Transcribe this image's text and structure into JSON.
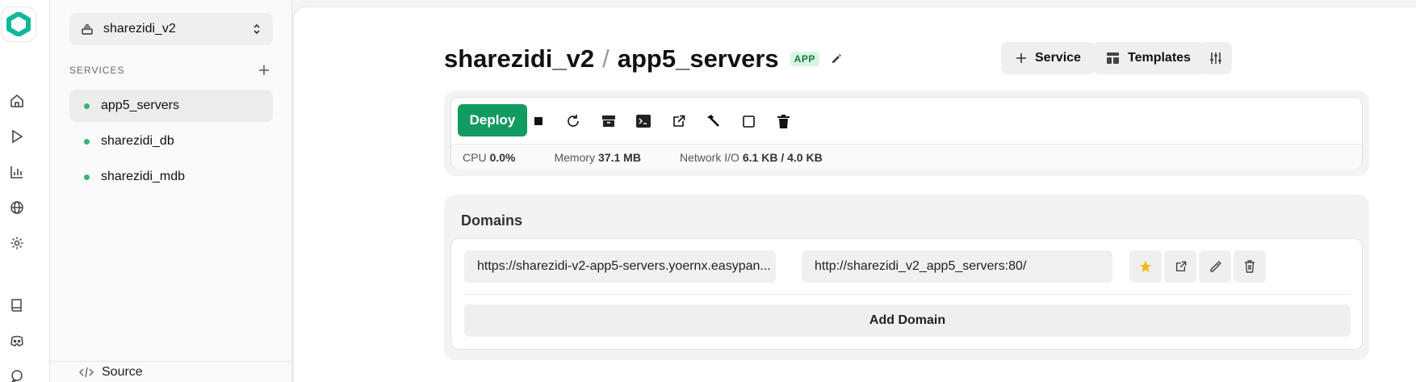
{
  "rail": {
    "icons": [
      "home-icon",
      "play-icon",
      "chart-icon",
      "globe-icon",
      "gear-icon",
      "book-icon",
      "discord-icon",
      "chat-icon"
    ]
  },
  "sidebar": {
    "project": "sharezidi_v2",
    "services_header": "SERVICES",
    "services": [
      {
        "name": "app5_servers",
        "status": "running",
        "active": true
      },
      {
        "name": "sharezidi_db",
        "status": "running",
        "active": false
      },
      {
        "name": "sharezidi_mdb",
        "status": "running",
        "active": false
      }
    ],
    "source_label": "Source"
  },
  "header": {
    "project": "sharezidi_v2",
    "separator": "/",
    "service": "app5_servers",
    "badge": "APP",
    "service_button": "Service",
    "templates_button": "Templates"
  },
  "controls": {
    "deploy_label": "Deploy",
    "icons": [
      "stop-icon",
      "restart-icon",
      "archive-icon",
      "terminal-icon",
      "open-external-icon",
      "build-icon",
      "square-icon",
      "trash-icon"
    ]
  },
  "stats": {
    "cpu_label": "CPU",
    "cpu_value": "0.0%",
    "memory_label": "Memory",
    "memory_value": "37.1 MB",
    "network_label": "Network I/O",
    "network_value": "6.1 KB / 4.0 KB"
  },
  "domains": {
    "title": "Domains",
    "items": [
      {
        "public_url": "https://sharezidi-v2-app5-servers.yoernx.easypan...",
        "target_url": "http://sharezidi_v2_app5_servers:80/",
        "primary": true
      }
    ],
    "add_label": "Add Domain"
  },
  "colors": {
    "accent": "#119b60",
    "status_running": "#3cb371",
    "badge_bg": "#d7f5e1",
    "star": "#f5b800"
  }
}
